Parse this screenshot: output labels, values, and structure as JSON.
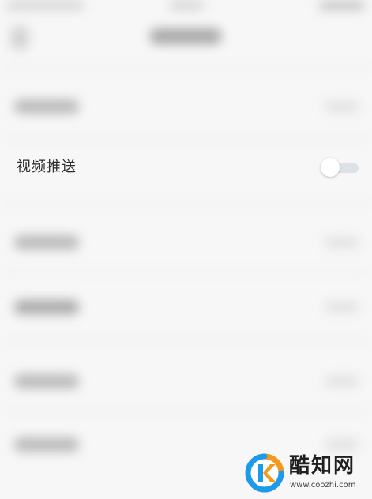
{
  "setting": {
    "label": "视频推送",
    "toggle_on": false
  },
  "watermark": {
    "name": "酷知网",
    "url": "www.coozhi.com"
  },
  "colors": {
    "background": "#f7f7f7",
    "toggle_track": "#dde1e8",
    "toggle_knob": "#ffffff",
    "logo_orange": "#f39a1e",
    "logo_blue": "#1e9be8"
  }
}
